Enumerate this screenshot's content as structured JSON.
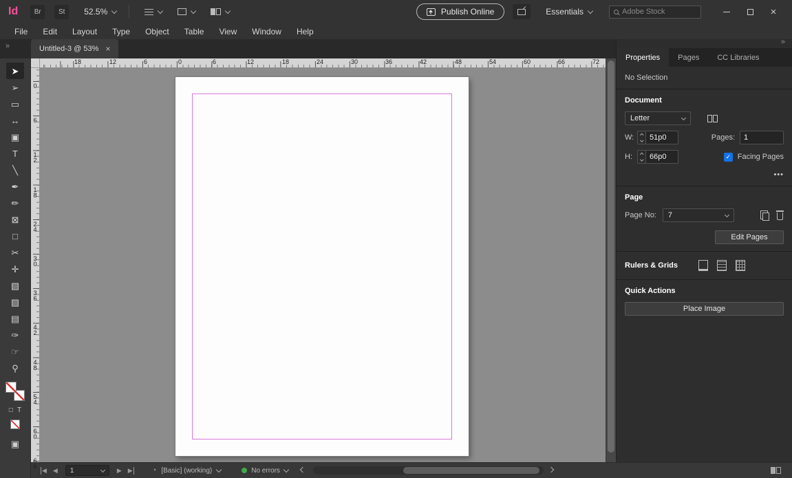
{
  "colors": {
    "brand_pink": "#ff4f9e",
    "checkbox_blue": "#1473e6",
    "margin_guide": "#d878d8",
    "status_green": "#3fa94c"
  },
  "icons": {
    "expand_dock": "»",
    "close_window": "×",
    "close_tab": "×",
    "more_options": "•••",
    "checkmark": "✓",
    "nav_prev": "◀",
    "nav_next": "▶",
    "preflight": "◔"
  },
  "titlebar": {
    "logo": "Id",
    "bridge_label": "Br",
    "stock_badge_label": "St",
    "zoom_level": "52.5%",
    "publish_label": "Publish Online",
    "workspace_label": "Essentials",
    "search_placeholder": "Adobe Stock"
  },
  "menubar": {
    "items": [
      "File",
      "Edit",
      "Layout",
      "Type",
      "Object",
      "Table",
      "View",
      "Window",
      "Help"
    ]
  },
  "tabstrip": {
    "document_title": "Untitled-3 @ 53%"
  },
  "toolbar": {
    "tools": [
      "➤",
      "➢",
      "▭",
      "↔",
      "▣",
      "T",
      "╲",
      "✒",
      "✏",
      "⊠",
      "□",
      "✂",
      "✛",
      "▧",
      "▨",
      "▤",
      "✑",
      "☞",
      "⚲"
    ],
    "format_container": "□",
    "format_text": "T",
    "screen_mode": "▣"
  },
  "rulers": {
    "horizontal": [
      "18",
      "12",
      "6",
      "0",
      "6",
      "12",
      "18",
      "24",
      "30",
      "36",
      "42",
      "48",
      "54",
      "60",
      "66",
      "72"
    ],
    "vertical": [
      "0",
      "6",
      "12",
      "18",
      "24",
      "30",
      "36",
      "42",
      "48",
      "54",
      "60",
      "66"
    ]
  },
  "panel": {
    "tab_properties": "Properties",
    "tab_pages": "Pages",
    "tab_cc": "CC Libraries",
    "no_selection": "No Selection",
    "document": {
      "header": "Document",
      "preset": "Letter",
      "w_label": "W:",
      "w_value": "51p0",
      "h_label": "H:",
      "h_value": "66p0",
      "pages_label": "Pages:",
      "pages_value": "1",
      "facing_pages_label": "Facing Pages"
    },
    "page": {
      "header": "Page",
      "page_no_label": "Page No:",
      "page_no_value": "7",
      "edit_pages_label": "Edit Pages"
    },
    "rulers_grids": {
      "header": "Rulers & Grids"
    },
    "quick_actions": {
      "header": "Quick Actions",
      "place_image_label": "Place Image"
    }
  },
  "statusbar": {
    "page_value": "1",
    "preflight_profile": "[Basic] (working)",
    "error_status": "No errors"
  }
}
